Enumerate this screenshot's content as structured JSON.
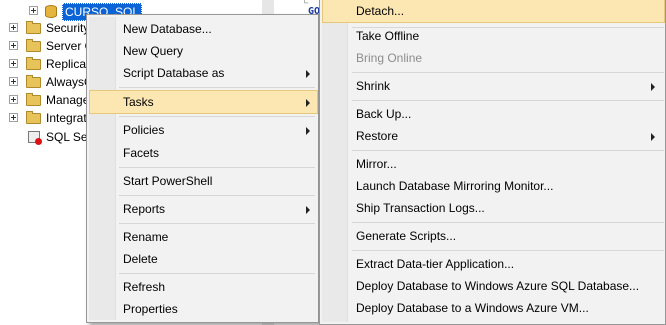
{
  "explorer": {
    "database": "CURSO_SQL",
    "items": [
      "Security",
      "Server O",
      "Replicat",
      "AlwaysO",
      "Manage",
      "Integrat",
      "SQL Ser"
    ]
  },
  "editor": {
    "keyword": "GO"
  },
  "context_menu": [
    {
      "label": "New Database..."
    },
    {
      "label": "New Query"
    },
    {
      "label": "Script Database as",
      "submenu": true
    },
    {
      "label": "Tasks",
      "submenu": true,
      "highlighted": true
    },
    {
      "label": "Policies",
      "submenu": true
    },
    {
      "label": "Facets"
    },
    {
      "label": "Start PowerShell"
    },
    {
      "label": "Reports",
      "submenu": true
    },
    {
      "label": "Rename"
    },
    {
      "label": "Delete"
    },
    {
      "label": "Refresh"
    },
    {
      "label": "Properties"
    }
  ],
  "tasks_submenu": [
    {
      "label": "Detach...",
      "highlighted": true
    },
    {
      "label": "Take Offline"
    },
    {
      "label": "Bring Online",
      "disabled": true
    },
    {
      "label": "Shrink",
      "submenu": true
    },
    {
      "label": "Back Up..."
    },
    {
      "label": "Restore",
      "submenu": true
    },
    {
      "label": "Mirror..."
    },
    {
      "label": "Launch Database Mirroring Monitor..."
    },
    {
      "label": "Ship Transaction Logs..."
    },
    {
      "label": "Generate Scripts..."
    },
    {
      "label": "Extract Data-tier Application..."
    },
    {
      "label": "Deploy Database to Windows Azure SQL Database..."
    },
    {
      "label": "Deploy Database to a Windows Azure VM..."
    }
  ],
  "colors": {
    "selection": "#0a64d8",
    "menu_highlight": "#fce7b3",
    "menu_background": "#f2f2f2"
  }
}
